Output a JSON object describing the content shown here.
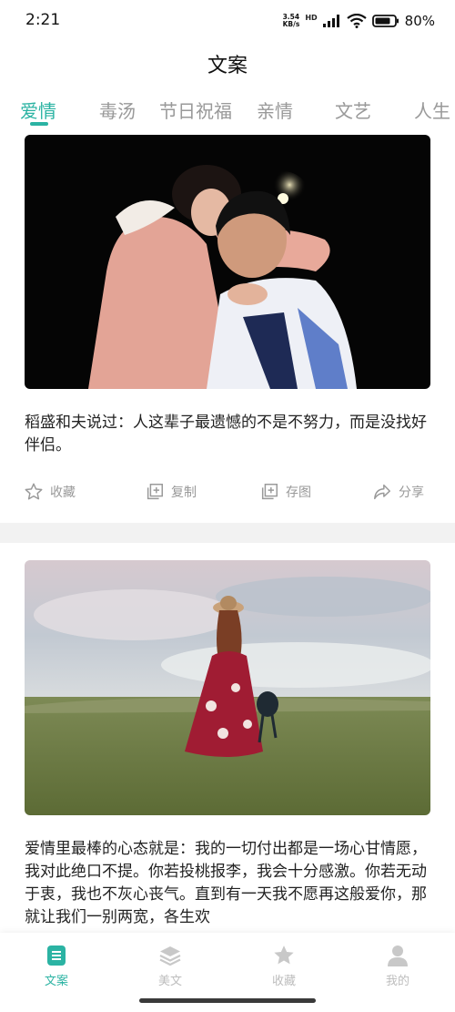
{
  "status_bar": {
    "time": "2:21",
    "net_speed_value": "3.54",
    "net_speed_unit": "KB/s",
    "battery": "80%",
    "icons": [
      "hd-icon",
      "signal-icon",
      "wifi-icon",
      "battery-icon"
    ]
  },
  "header": {
    "title": "文案"
  },
  "tabs": [
    {
      "label": "爱情",
      "active": true
    },
    {
      "label": "毒汤",
      "active": false
    },
    {
      "label": "节日祝福",
      "active": false
    },
    {
      "label": "亲情",
      "active": false
    },
    {
      "label": "文艺",
      "active": false
    },
    {
      "label": "人生",
      "active": false
    }
  ],
  "feed": {
    "cards": [
      {
        "image": "couple-photo",
        "text": "稻盛和夫说过：人这辈子最遗憾的不是不努力，而是没找好伴侣。",
        "actions": [
          {
            "label": "收藏",
            "icon": "star-icon"
          },
          {
            "label": "复制",
            "icon": "copy-icon"
          },
          {
            "label": "存图",
            "icon": "save-image-icon"
          },
          {
            "label": "分享",
            "icon": "share-icon"
          }
        ]
      },
      {
        "image": "woman-in-field-photo",
        "text": "爱情里最棒的心态就是：我的一切付出都是一场心甘情愿，我对此绝口不提。你若投桃报李，我会十分感激。你若无动于衷，我也不灰心丧气。直到有一天我不愿再这般爱你，那就让我们一别两宽，各生欢"
      }
    ]
  },
  "bottom_nav": [
    {
      "label": "文案",
      "icon": "document-icon",
      "active": true
    },
    {
      "label": "美文",
      "icon": "layers-icon",
      "active": false
    },
    {
      "label": "收藏",
      "icon": "star-icon",
      "active": false
    },
    {
      "label": "我的",
      "icon": "person-icon",
      "active": false
    }
  ],
  "colors": {
    "accent": "#2bb3a3",
    "inactive": "#999999",
    "nav_inactive": "#bdbdbd"
  }
}
